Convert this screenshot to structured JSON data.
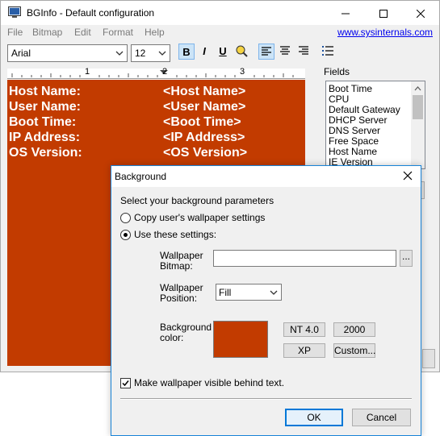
{
  "window": {
    "title": "BGInfo - Default configuration",
    "minimize": "—",
    "maximize": "☐",
    "close": "✕"
  },
  "menu": {
    "items": [
      "File",
      "Bitmap",
      "Edit",
      "Format",
      "Help"
    ],
    "link": "www.sysinternals.com"
  },
  "toolbar": {
    "font": "Arial",
    "size": "12",
    "bold": "B",
    "italic": "I",
    "underline": "U"
  },
  "ruler": {
    "marks": [
      "1",
      "2",
      "3"
    ]
  },
  "editor": {
    "background_color": "#c23b00",
    "rows": [
      {
        "label": "Host Name:",
        "value": "<Host Name>"
      },
      {
        "label": "User Name:",
        "value": "<User Name>"
      },
      {
        "label": "Boot Time:",
        "value": "<Boot Time>"
      },
      {
        "label": "IP Address:",
        "value": "<IP Address>"
      },
      {
        "label": "OS Version:",
        "value": "<OS Version>"
      }
    ]
  },
  "fields": {
    "label": "Fields",
    "items": [
      "Boot Time",
      "CPU",
      "Default Gateway",
      "DHCP Server",
      "DNS Server",
      "Free Space",
      "Host Name",
      "IE Version"
    ]
  },
  "dialog": {
    "title": "Background",
    "prompt": "Select your background parameters",
    "radio_copy": "Copy user's wallpaper settings",
    "radio_use": "Use these settings:",
    "wallpaper_bitmap_label": "Wallpaper\nBitmap:",
    "wallpaper_bitmap_value": "",
    "browse": "...",
    "wallpaper_position_label": "Wallpaper\nPosition:",
    "wallpaper_position_value": "Fill",
    "background_color_label": "Background\ncolor:",
    "background_color": "#c23b00",
    "btn_nt4": "NT 4.0",
    "btn_2000": "2000",
    "btn_xp": "XP",
    "btn_custom": "Custom...",
    "checkbox_label": "Make wallpaper visible behind text.",
    "checkbox_checked": true,
    "ok": "OK",
    "cancel": "Cancel"
  }
}
